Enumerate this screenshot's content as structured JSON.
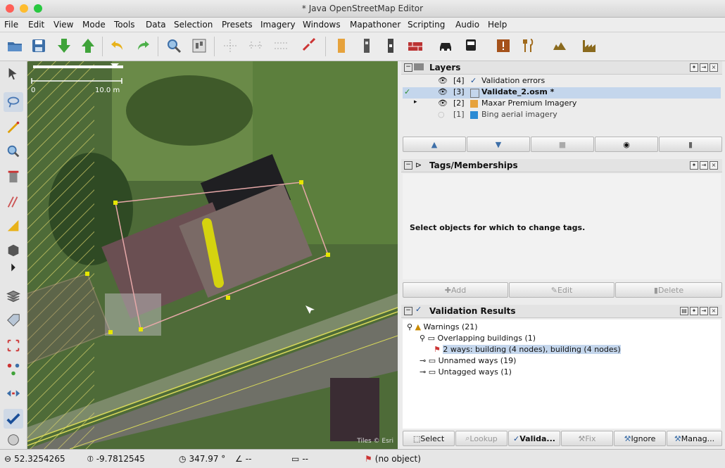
{
  "window": {
    "title": "* Java OpenStreetMap Editor"
  },
  "menu": [
    "File",
    "Edit",
    "View",
    "Mode",
    "Tools",
    "Data",
    "Selection",
    "Presets",
    "Imagery",
    "Windows",
    "Mapathoner",
    "Scripting",
    "Audio",
    "Help"
  ],
  "map": {
    "scale_left": "0",
    "scale_right": "10.0 m",
    "attribution": "Tiles © Esri"
  },
  "layers": {
    "title": "Layers",
    "items": [
      {
        "num": "[4]",
        "name": "Validation errors"
      },
      {
        "num": "[3]",
        "name": "Validate_2.osm *"
      },
      {
        "num": "[2]",
        "name": "Maxar Premium Imagery"
      },
      {
        "num": "[1]",
        "name": "Bing aerial imagery"
      }
    ]
  },
  "tags": {
    "title": "Tags/Memberships",
    "empty_message": "Select objects for which to change tags.",
    "add": "Add",
    "edit": "Edit",
    "delete": "Delete"
  },
  "validation": {
    "title": "Validation Results",
    "warnings": "Warnings (21)",
    "overlapping": "Overlapping buildings (1)",
    "selected_item": "2 ways: building (4 nodes), building (4 nodes)",
    "unnamed": "Unnamed ways (19)",
    "untagged": "Untagged ways (1)",
    "buttons": {
      "select": "Select",
      "lookup": "Lookup",
      "validate": "Valida...",
      "fix": "Fix",
      "ignore": "Ignore",
      "manage": "Manag..."
    }
  },
  "status": {
    "lat": "52.3254265",
    "lon": "-9.7812545",
    "heading": "347.97 °",
    "angle": "--",
    "length": "--",
    "object": "(no object)"
  },
  "colors": {
    "accent": "#e6e600",
    "selection": "#c4d6ec",
    "way": "#e6a8a8"
  }
}
